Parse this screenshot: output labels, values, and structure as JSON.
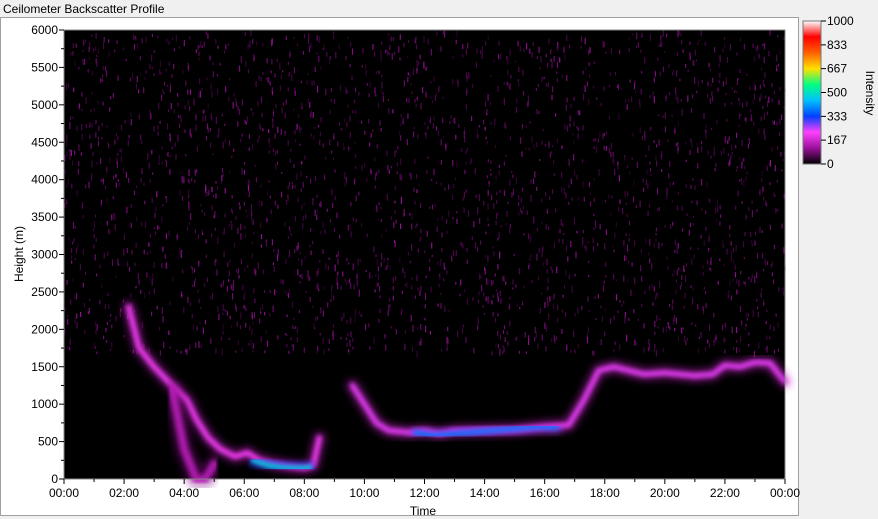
{
  "window": {
    "title": "Ceilometer Backscatter Profile"
  },
  "chart_data": {
    "type": "heatmap",
    "title": "",
    "xlabel": "Time",
    "ylabel": "Height (m)",
    "xlim": [
      "00:00",
      "24:00"
    ],
    "ylim": [
      0,
      6000
    ],
    "x_ticks": [
      "00:00",
      "02:00",
      "04:00",
      "06:00",
      "08:00",
      "10:00",
      "12:00",
      "14:00",
      "16:00",
      "18:00",
      "20:00",
      "22:00",
      "00:00"
    ],
    "y_ticks": [
      0,
      500,
      1000,
      1500,
      2000,
      2500,
      3000,
      3500,
      4000,
      4500,
      5000,
      5500,
      6000
    ],
    "colorbar": {
      "label": "Intensity",
      "range": [
        0,
        1000
      ],
      "ticks": [
        0,
        167,
        333,
        500,
        667,
        833,
        1000
      ],
      "tick_labels": [
        "0",
        "167",
        "333",
        "500",
        "667",
        "833",
        "1000"
      ],
      "colors": [
        "#000000",
        "#9b0f9b",
        "#ff40ff",
        "#0040ff",
        "#00c0ff",
        "#00ff80",
        "#ffe000",
        "#ff6000",
        "#ff0000",
        "#ffffff"
      ]
    },
    "grid": false,
    "layers": [
      {
        "name": "cloud-base-echo",
        "intensity": 220,
        "points": [
          [
            2.15,
            2300
          ],
          [
            2.5,
            1750
          ],
          [
            3.0,
            1500
          ],
          [
            3.6,
            1250
          ],
          [
            4.1,
            1050
          ],
          [
            4.4,
            800
          ],
          [
            4.8,
            550
          ],
          [
            5.2,
            400
          ],
          [
            5.7,
            300
          ],
          [
            6.1,
            350
          ],
          [
            6.5,
            250
          ],
          [
            7.0,
            200
          ],
          [
            7.5,
            170
          ],
          [
            8.0,
            150
          ],
          [
            8.3,
            180
          ],
          [
            8.5,
            550
          ]
        ]
      },
      {
        "name": "peak-echo",
        "intensity": 480,
        "points": [
          [
            6.3,
            250
          ],
          [
            6.8,
            180
          ],
          [
            7.3,
            150
          ],
          [
            7.8,
            140
          ],
          [
            8.2,
            150
          ]
        ]
      },
      {
        "name": "boundary-layer-top",
        "intensity": 230,
        "points": [
          [
            9.6,
            1250
          ],
          [
            10.0,
            1000
          ],
          [
            10.4,
            750
          ],
          [
            10.8,
            650
          ],
          [
            11.5,
            620
          ],
          [
            12.0,
            640
          ],
          [
            12.5,
            600
          ],
          [
            13.0,
            640
          ],
          [
            14.0,
            650
          ],
          [
            15.0,
            660
          ],
          [
            16.0,
            700
          ],
          [
            16.8,
            720
          ],
          [
            17.3,
            1050
          ],
          [
            17.8,
            1450
          ],
          [
            18.3,
            1500
          ],
          [
            18.8,
            1450
          ],
          [
            19.3,
            1400
          ],
          [
            20.0,
            1420
          ],
          [
            21.0,
            1380
          ],
          [
            21.6,
            1400
          ],
          [
            22.0,
            1520
          ],
          [
            22.5,
            1500
          ],
          [
            23.0,
            1560
          ],
          [
            23.5,
            1550
          ],
          [
            24.0,
            1300
          ]
        ]
      },
      {
        "name": "boundary-layer-peak",
        "intensity": 380,
        "points": [
          [
            11.7,
            620
          ],
          [
            12.3,
            580
          ],
          [
            15.8,
            700
          ],
          [
            16.4,
            690
          ]
        ]
      },
      {
        "name": "rain-fallstreak",
        "intensity": 140,
        "points": [
          [
            3.6,
            1200
          ],
          [
            4.0,
            400
          ],
          [
            4.4,
            0
          ],
          [
            4.7,
            0
          ],
          [
            5.0,
            200
          ]
        ]
      },
      {
        "name": "upper-noise",
        "intensity": 90,
        "range": [
          [
            0,
            24
          ],
          [
            1700,
            6000
          ]
        ]
      }
    ]
  }
}
